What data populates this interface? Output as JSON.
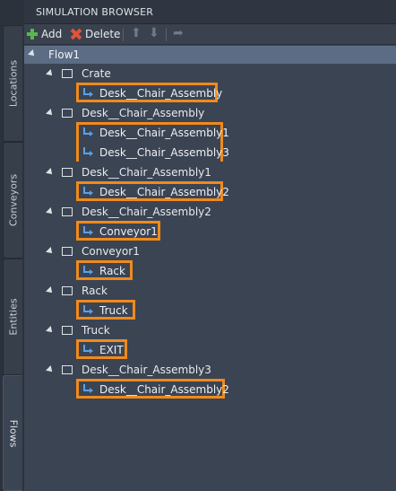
{
  "panel": {
    "title": "SIMULATION BROWSER"
  },
  "toolbar": {
    "add_label": "Add",
    "delete_label": "Delete"
  },
  "tabs": [
    {
      "label": "Locations"
    },
    {
      "label": "Conveyors"
    },
    {
      "label": "Entities"
    },
    {
      "label": "Flows",
      "active": true
    }
  ],
  "tree": {
    "root": "Flow1",
    "groups": [
      {
        "parent": "Crate",
        "children": [
          "Desk__Chair_Assembly"
        ]
      },
      {
        "parent": "Desk__Chair_Assembly",
        "children": [
          "Desk__Chair_Assembly1",
          "Desk__Chair_Assembly3"
        ]
      },
      {
        "parent": "Desk__Chair_Assembly1",
        "children": [
          "Desk__Chair_Assembly2"
        ]
      },
      {
        "parent": "Desk__Chair_Assembly2",
        "children": [
          "Conveyor1"
        ]
      },
      {
        "parent": "Conveyor1",
        "children": [
          "Rack"
        ]
      },
      {
        "parent": "Rack",
        "children": [
          "Truck"
        ]
      },
      {
        "parent": "Truck",
        "children": [
          "EXIT"
        ]
      },
      {
        "parent": "Desk__Chair_Assembly3",
        "children": [
          "Desk__Chair_Assembly2"
        ]
      }
    ]
  },
  "colors": {
    "highlight": "#f08a1c",
    "background": "#3b4453",
    "flow_selected": "#5b6c84"
  }
}
